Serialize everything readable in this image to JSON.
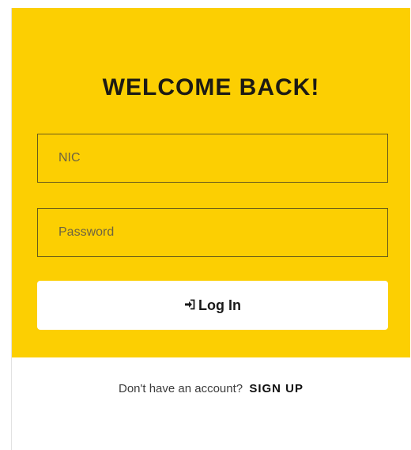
{
  "login": {
    "title": "WELCOME BACK!",
    "nic_placeholder": "NIC",
    "password_placeholder": "Password",
    "login_button_label": "Log In",
    "login_icon": "sign-in-icon",
    "signup_prompt": "Don't have an account?",
    "signup_link": "SIGN UP"
  },
  "colors": {
    "panel": "#fccf02",
    "button_bg": "#ffffff",
    "text": "#1c1a14"
  }
}
